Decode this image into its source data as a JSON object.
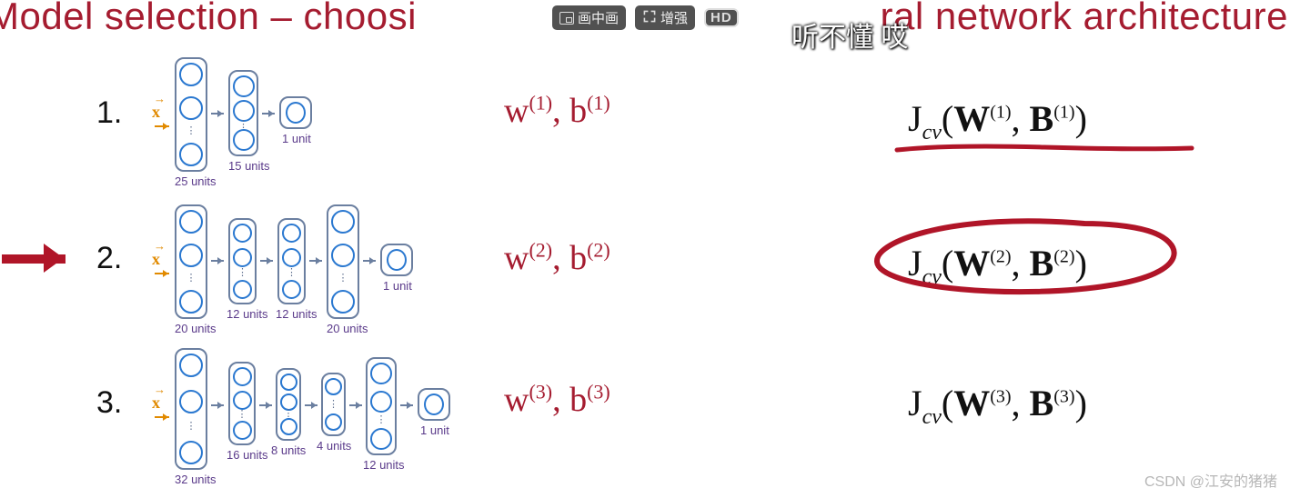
{
  "title": {
    "left": "Model selection – choosi",
    "right": "ral network architecture"
  },
  "overlay": {
    "pip": "画中画",
    "enhance": "增强",
    "hd": "HD"
  },
  "danmaku": {
    "text": "听不懂 哎"
  },
  "rows": {
    "1": {
      "num": "1.",
      "x": "x",
      "params_html": "w<sup>(1)</sup>, b<sup>(1)</sup>",
      "jcv_html": "J<sub>cv</sub>(<b>W</b><sup>(1)</sup>, <b>B</b><sup>(1)</sup>)",
      "layers": [
        {
          "units": "25 units"
        },
        {
          "units": "15 units"
        },
        {
          "units": "1 unit"
        }
      ]
    },
    "2": {
      "num": "2.",
      "x": "x",
      "params_html": "w<sup>(2)</sup>, b<sup>(2)</sup>",
      "jcv_html": "J<sub>cv</sub>(<b>W</b><sup>(2)</sup>, <b>B</b><sup>(2)</sup>)",
      "layers": [
        {
          "units": "20 units"
        },
        {
          "units": "12 units"
        },
        {
          "units": "12 units"
        },
        {
          "units": "20 units"
        },
        {
          "units": "1 unit"
        }
      ]
    },
    "3": {
      "num": "3.",
      "x": "x",
      "params_html": "w<sup>(3)</sup>, b<sup>(3)</sup>",
      "jcv_html": "J<sub>cv</sub>(<b>W</b><sup>(3)</sup>, <b>B</b><sup>(3)</sup>)",
      "layers": [
        {
          "units": "32 units"
        },
        {
          "units": "16 units"
        },
        {
          "units": "8 units"
        },
        {
          "units": "4 units"
        },
        {
          "units": "12 units"
        },
        {
          "units": "1 unit"
        }
      ]
    }
  },
  "watermark": "CSDN @江安的猪猪"
}
